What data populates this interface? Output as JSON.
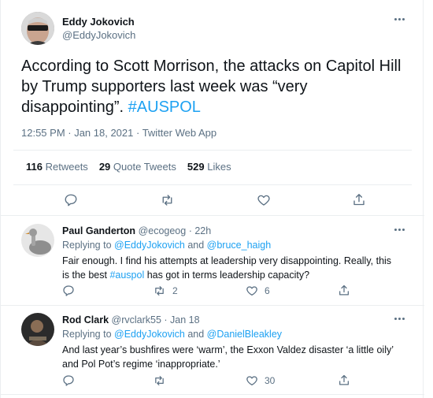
{
  "main_tweet": {
    "author_name": "Eddy Jokovich",
    "author_handle": "@EddyJokovich",
    "text_line1": "According to Scott Morrison, the attacks on Capitol Hill",
    "text_line2": "by Trump supporters last week was “very",
    "text_line3_prefix": "disappointing”. ",
    "hashtag": "#AUSPOL",
    "timestamp": "12:55 PM · Jan 18, 2021 · Twitter Web App",
    "retweets_count": "116",
    "retweets_label": "Retweets",
    "quote_count": "29",
    "quote_label": "Quote Tweets",
    "likes_count": "529",
    "likes_label": "Likes"
  },
  "replies": [
    {
      "author_name": "Paul Ganderton",
      "author_handle": "@ecogeog",
      "time": "· 22h",
      "replying_prefix": "Replying to ",
      "replying_to_1": "@EddyJokovich",
      "replying_and": " and ",
      "replying_to_2": "@bruce_haigh",
      "text_line1": "Fair enough. I find his attempts at leadership very disappointing. Really, this",
      "text_line2_prefix": "is the best ",
      "text_line2_hashtag": "#auspol",
      "text_line2_suffix": " has got in terms leadership capacity?",
      "reply_count": "",
      "retweet_count": "2",
      "like_count": "6"
    },
    {
      "author_name": "Rod Clark",
      "author_handle": "@rvclark55",
      "time": "· Jan 18",
      "replying_prefix": "Replying to ",
      "replying_to_1": "@EddyJokovich",
      "replying_and": " and ",
      "replying_to_2": "@DanielBleakley",
      "text_line1": "And last year’s bushfires were ‘warm’, the Exxon Valdez disaster ‘a little oily’",
      "text_line2": "and Pol Pot’s regime ‘inappropriate.’",
      "reply_count": "",
      "retweet_count": "",
      "like_count": "30"
    }
  ],
  "colors": {
    "accent": "#1da1f2",
    "secondary_text": "#5b7083",
    "divider": "#ebeef0"
  }
}
